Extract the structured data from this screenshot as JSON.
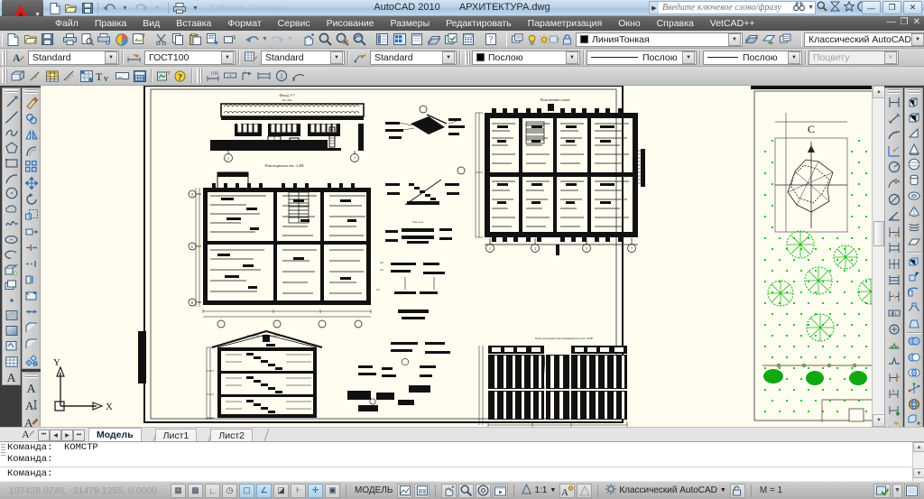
{
  "window": {
    "app_title": "AutoCAD 2010",
    "document_title": "АРХИТЕКТУРА.dwg",
    "minimize": "—",
    "restore": "❐",
    "close": "✕",
    "min2": "—",
    "rest2": "❐",
    "close2": "✕"
  },
  "quick_access": {
    "icons": [
      "new-icon",
      "open-icon",
      "save-icon",
      "undo-icon",
      "redo-icon",
      "plot-icon"
    ],
    "faded_label": "Добавить Чертежи ..."
  },
  "search": {
    "placeholder": "Введите ключевое слово/фразу",
    "icons": [
      "binoculars-icon",
      "search-icon",
      "sign-in-icon",
      "favorites-icon",
      "help-icon"
    ]
  },
  "menubar": {
    "items": [
      "Файл",
      "Правка",
      "Вид",
      "Вставка",
      "Формат",
      "Сервис",
      "Рисование",
      "Размеры",
      "Редактировать",
      "Параметризация",
      "Окно",
      "Справка",
      "VetCAD++"
    ]
  },
  "toolbar_standard": {
    "icons": [
      "new-file-icon",
      "open-folder-icon",
      "save-icon",
      "plot-icon",
      "plot-preview-icon",
      "publish-icon",
      "plotstyle-icon",
      "export-pdf-icon",
      "cut-icon",
      "copy-icon",
      "paste-icon",
      "matchprop-icon",
      "block-editor-icon",
      "undo-icon",
      "redo-icon",
      "pan-icon",
      "zoom-realtime-icon",
      "zoom-window-icon",
      "zoom-previous-icon",
      "properties-icon",
      "designcenter-icon",
      "toolpalettes-icon",
      "sheetset-icon",
      "markup-icon",
      "calculator-icon",
      "help-icon"
    ]
  },
  "toolbar_layers": {
    "layer_props_icon": "layer-properties-icon",
    "state_icons": [
      "bulb-icon",
      "sun-icon",
      "freeze-icon",
      "lock-icon"
    ],
    "current_layer": "ЛинияТонкая",
    "trailing_icons": [
      "previous-layer-icon",
      "make-current-icon",
      "layer-match-icon"
    ],
    "workspace": "Классический AutoCAD",
    "workspace_icons": [
      "workspace-settings-icon",
      "workspace-lock-icon"
    ]
  },
  "toolbar_styles": {
    "items": [
      {
        "icon": "text-style-icon",
        "value": "Standard"
      },
      {
        "icon": "dim-style-icon",
        "value": "ГОСТ100"
      },
      {
        "icon": "table-style-icon",
        "value": "Standard"
      },
      {
        "icon": "mleader-style-icon",
        "value": "Standard"
      }
    ]
  },
  "toolbar_properties": {
    "color": {
      "value": "Послою",
      "swatch": "#000000"
    },
    "linetype": {
      "value": "Послою"
    },
    "lineweight": {
      "value": "Послою"
    },
    "plotstyle": {
      "value": "Поцвету",
      "disabled": true
    }
  },
  "toolbar_extra": {
    "group1": [
      "insert-block-icon",
      "point-style-icon",
      "table-icon",
      "hatch-icon",
      "region-icon",
      "multiline-text-icon",
      "wipeout-icon",
      "field-icon",
      "revcloud-icon",
      "help-query-icon"
    ],
    "group2": [
      "dim-linear-icon",
      "dim-aligned-icon",
      "dim-leader-icon",
      "dim-baseline-icon",
      "dim-balloon-icon",
      "dim-arc-icon"
    ]
  },
  "left_toolbar_draw": {
    "name": "Рисование",
    "icons": [
      "line-icon",
      "ray-icon",
      "polyline-icon",
      "polygon-icon",
      "rectangle-icon",
      "arc-icon",
      "circle-icon",
      "revcloud-icon",
      "spline-icon",
      "ellipse-icon",
      "ellipse-arc-icon",
      "insert-block-icon",
      "make-block-icon",
      "point-icon",
      "hatch-icon",
      "gradient-icon",
      "region-icon",
      "table-icon",
      "multiline-text-icon"
    ]
  },
  "left_toolbar_modify": {
    "name": "Редактировать",
    "icons": [
      "erase-icon",
      "copy-icon",
      "mirror-icon",
      "offset-icon",
      "array-icon",
      "move-icon",
      "rotate-icon",
      "scale-icon",
      "stretch-icon",
      "trim-icon",
      "extend-icon",
      "break-icon",
      "break-at-point-icon",
      "join-icon",
      "chamfer-icon",
      "fillet-icon",
      "explode-icon"
    ]
  },
  "left_toolbar_text": {
    "name": "Текст",
    "icons": [
      "multiline-text-icon",
      "single-line-text-icon",
      "edit-text-icon",
      "find-replace-icon",
      "spell-check-icon",
      "text-style-icon"
    ]
  },
  "right_toolbar_dimension": {
    "name": "Размеры",
    "icons": [
      "dim-linear-icon",
      "dim-aligned-icon",
      "dim-arc-icon",
      "dim-ordinate-icon",
      "dim-radius-icon",
      "dim-jogged-icon",
      "dim-diameter-icon",
      "dim-angular-icon",
      "dim-quick-icon",
      "dim-baseline-icon",
      "dim-continue-icon",
      "dim-space-icon",
      "dim-break-icon",
      "dim-tolerance-icon",
      "dim-center-icon",
      "dim-inspect-icon",
      "dim-jogline-icon",
      "dim-edit-icon",
      "dim-text-edit-icon",
      "dim-update-icon",
      "dim-style-icon"
    ]
  },
  "right_toolbar_modeling": {
    "name": "Моделирование",
    "icons": [
      "polysolid-icon",
      "box-icon",
      "wedge-icon",
      "cone-icon",
      "sphere-icon",
      "cylinder-icon",
      "torus-icon",
      "pyramid-icon",
      "helix-icon",
      "planar-surface-icon",
      "extrude-icon",
      "press-pull-icon",
      "revolve-icon",
      "sweep-icon",
      "loft-icon",
      "union-icon",
      "subtract-icon",
      "intersect-icon",
      "3d-move-icon",
      "3d-rotate-icon",
      "3d-align-icon",
      "3d-array-icon"
    ]
  },
  "drawing": {
    "title_left_top": "Фасад 1-7",
    "label_plan1": "План подвала на отм.",
    "label_plan2": "План типового этажа",
    "label_facade": "Разрез по лестничной клетке",
    "label_section": "План раскладки плит перекрытия на отм. 0.000",
    "wind_rose_label": "С",
    "ucs_x": "X",
    "ucs_y": "Y"
  },
  "layout_tabs": {
    "nav": [
      "⏮",
      "◀",
      "▶",
      "⏭"
    ],
    "tabs": [
      {
        "label": "Модель",
        "active": true
      },
      {
        "label": "Лист1",
        "active": false
      },
      {
        "label": "Лист2",
        "active": false
      }
    ],
    "style_icon": "layout-style-icon"
  },
  "command_window": {
    "lines": [
      "Команда:  КОМСТР",
      "Команда:"
    ],
    "prompt": "Команда:"
  },
  "statusbar": {
    "coordinates": "107428.0746, -31479.1255, 0.0000",
    "toggles": [
      {
        "name": "snap-toggle",
        "icon": "▦",
        "on": false
      },
      {
        "name": "grid-toggle",
        "icon": "▩",
        "on": false
      },
      {
        "name": "ortho-toggle",
        "icon": "∟",
        "on": false
      },
      {
        "name": "polar-toggle",
        "icon": "◷",
        "on": false
      },
      {
        "name": "osnap-toggle",
        "icon": "▢",
        "on": true
      },
      {
        "name": "otrack-toggle",
        "icon": "∠",
        "on": true
      },
      {
        "name": "ducs-toggle",
        "icon": "◪",
        "on": false
      },
      {
        "name": "dyn-toggle",
        "icon": "⊦",
        "on": false
      },
      {
        "name": "lwt-toggle",
        "icon": "✛",
        "on": true
      },
      {
        "name": "qp-toggle",
        "icon": "▣",
        "on": false
      }
    ],
    "space_label": "МОДЕЛЬ",
    "space_icons": [
      "model-space-icon",
      "layout-space-icon"
    ],
    "view_icons": [
      "pan-icon",
      "zoom-icon",
      "steeringwheel-icon",
      "showmotion-icon"
    ],
    "annotation_scale": "1:1",
    "annoscale_icons": [
      "annoscale-icon",
      "annovis-icon",
      "annoadd-icon"
    ],
    "workspace": "Классический AutoCAD",
    "workspace_icon": "workspace-gear-icon",
    "lock_icon": "toolbar-lock-icon",
    "monitor_label": "M = 1",
    "tray_icons": [
      "tray-status-icon",
      "tray-expand-icon",
      "clean-screen-icon"
    ]
  }
}
